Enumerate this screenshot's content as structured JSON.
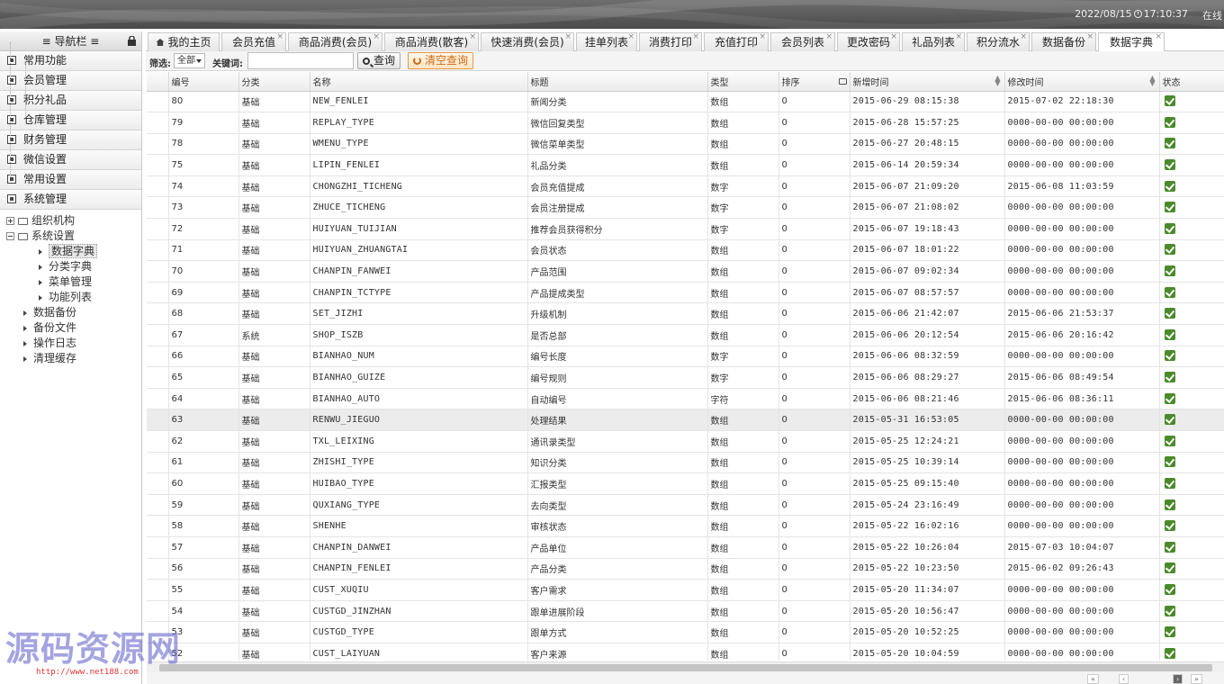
{
  "header": {
    "datetime": "2022/08/15",
    "time": "17:10:37",
    "online": "在线"
  },
  "sidebar": {
    "title": "≡ 导航栏 ≡",
    "menu": [
      "常用功能",
      "会员管理",
      "积分礼品",
      "仓库管理",
      "财务管理",
      "微信设置",
      "常用设置",
      "系统管理"
    ],
    "tree": {
      "org": "组织机构",
      "sys": "系统设置",
      "sys_children": [
        "数据字典",
        "分类字典",
        "菜单管理",
        "功能列表"
      ],
      "others": [
        "数据备份",
        "备份文件",
        "操作日志",
        "清理缓存"
      ]
    }
  },
  "tabs": [
    "我的主页",
    "会员充值",
    "商品消费(会员)",
    "商品消费(散客)",
    "快速消费(会员)",
    "挂单列表",
    "消费打印",
    "充值打印",
    "会员列表",
    "更改密码",
    "礼品列表",
    "积分流水",
    "数据备份",
    "数据字典"
  ],
  "toolbar": {
    "filter_label": "筛选:",
    "filter_value": "全部",
    "keyword_label": "关键词:",
    "keyword_value": "",
    "search_label": "查询",
    "clear_label": "清空查询"
  },
  "table": {
    "columns": [
      "编号",
      "分类",
      "名称",
      "标题",
      "类型",
      "排序",
      "新增时间",
      "修改时间",
      "状态"
    ],
    "rows": [
      [
        "80",
        "基础",
        "NEW_FENLEI",
        "新闻分类",
        "数组",
        "0",
        "2015-06-29 08:15:38",
        "2015-07-02 22:18:30"
      ],
      [
        "79",
        "基础",
        "REPLAY_TYPE",
        "微信回复类型",
        "数组",
        "0",
        "2015-06-28 15:57:25",
        "0000-00-00 00:00:00"
      ],
      [
        "78",
        "基础",
        "WMENU_TYPE",
        "微信菜单类型",
        "数组",
        "0",
        "2015-06-27 20:48:15",
        "0000-00-00 00:00:00"
      ],
      [
        "75",
        "基础",
        "LIPIN_FENLEI",
        "礼品分类",
        "数组",
        "0",
        "2015-06-14 20:59:34",
        "0000-00-00 00:00:00"
      ],
      [
        "74",
        "基础",
        "CHONGZHI_TICHENG",
        "会员充值提成",
        "数字",
        "0",
        "2015-06-07 21:09:20",
        "2015-06-08 11:03:59"
      ],
      [
        "73",
        "基础",
        "ZHUCE_TICHENG",
        "会员注册提成",
        "数字",
        "0",
        "2015-06-07 21:08:02",
        "0000-00-00 00:00:00"
      ],
      [
        "72",
        "基础",
        "HUIYUAN_TUIJIAN",
        "推荐会员获得积分",
        "数字",
        "0",
        "2015-06-07 19:18:43",
        "0000-00-00 00:00:00"
      ],
      [
        "71",
        "基础",
        "HUIYUAN_ZHUANGTAI",
        "会员状态",
        "数组",
        "0",
        "2015-06-07 18:01:22",
        "0000-00-00 00:00:00"
      ],
      [
        "70",
        "基础",
        "CHANPIN_FANWEI",
        "产品范围",
        "数组",
        "0",
        "2015-06-07 09:02:34",
        "0000-00-00 00:00:00"
      ],
      [
        "69",
        "基础",
        "CHANPIN_TCTYPE",
        "产品提成类型",
        "数组",
        "0",
        "2015-06-07 08:57:57",
        "0000-00-00 00:00:00"
      ],
      [
        "68",
        "基础",
        "SET_JIZHI",
        "升级机制",
        "数组",
        "0",
        "2015-06-06 21:42:07",
        "2015-06-06 21:53:37"
      ],
      [
        "67",
        "系统",
        "SHOP_ISZB",
        "是否总部",
        "数组",
        "0",
        "2015-06-06 20:12:54",
        "2015-06-06 20:16:42"
      ],
      [
        "66",
        "基础",
        "BIANHAO_NUM",
        "编号长度",
        "数字",
        "0",
        "2015-06-06 08:32:59",
        "0000-00-00 00:00:00"
      ],
      [
        "65",
        "基础",
        "BIANHAO_GUIZE",
        "编号规则",
        "数字",
        "0",
        "2015-06-06 08:29:27",
        "2015-06-06 08:49:54"
      ],
      [
        "64",
        "基础",
        "BIANHAO_AUTO",
        "自动编号",
        "字符",
        "0",
        "2015-06-06 08:21:46",
        "2015-06-06 08:36:11"
      ],
      [
        "63",
        "基础",
        "RENWU_JIEGUO",
        "处理结果",
        "数组",
        "0",
        "2015-05-31 16:53:05",
        "0000-00-00 00:00:00"
      ],
      [
        "62",
        "基础",
        "TXL_LEIXING",
        "通讯录类型",
        "数组",
        "0",
        "2015-05-25 12:24:21",
        "0000-00-00 00:00:00"
      ],
      [
        "61",
        "基础",
        "ZHISHI_TYPE",
        "知识分类",
        "数组",
        "0",
        "2015-05-25 10:39:14",
        "0000-00-00 00:00:00"
      ],
      [
        "60",
        "基础",
        "HUIBAO_TYPE",
        "汇报类型",
        "数组",
        "0",
        "2015-05-25 09:15:40",
        "0000-00-00 00:00:00"
      ],
      [
        "59",
        "基础",
        "QUXIANG_TYPE",
        "去向类型",
        "数组",
        "0",
        "2015-05-24 23:16:49",
        "0000-00-00 00:00:00"
      ],
      [
        "58",
        "基础",
        "SHENHE",
        "审核状态",
        "数组",
        "0",
        "2015-05-22 16:02:16",
        "0000-00-00 00:00:00"
      ],
      [
        "57",
        "基础",
        "CHANPIN_DANWEI",
        "产品单位",
        "数组",
        "0",
        "2015-05-22 10:26:04",
        "2015-07-03 10:04:07"
      ],
      [
        "56",
        "基础",
        "CHANPIN_FENLEI",
        "产品分类",
        "数组",
        "0",
        "2015-05-22 10:23:50",
        "2015-06-02 09:26:43"
      ],
      [
        "55",
        "基础",
        "CUST_XUQIU",
        "客户需求",
        "数组",
        "0",
        "2015-05-20 11:34:07",
        "0000-00-00 00:00:00"
      ],
      [
        "54",
        "基础",
        "CUSTGD_JINZHAN",
        "跟单进展阶段",
        "数组",
        "0",
        "2015-05-20 10:56:47",
        "0000-00-00 00:00:00"
      ],
      [
        "53",
        "基础",
        "CUSTGD_TYPE",
        "跟单方式",
        "数组",
        "0",
        "2015-05-20 10:52:25",
        "0000-00-00 00:00:00"
      ],
      [
        "52",
        "基础",
        "CUST_LAIYUAN",
        "客户来源",
        "数组",
        "0",
        "2015-05-20 10:04:59",
        "0000-00-00 00:00:00"
      ]
    ]
  },
  "watermark": {
    "text": "源码资源网",
    "url": "http://www.net188.com"
  },
  "colors": {
    "status_check": "#4a8a2a",
    "clear_button": "#d06a10",
    "header_bg": "#555555"
  }
}
